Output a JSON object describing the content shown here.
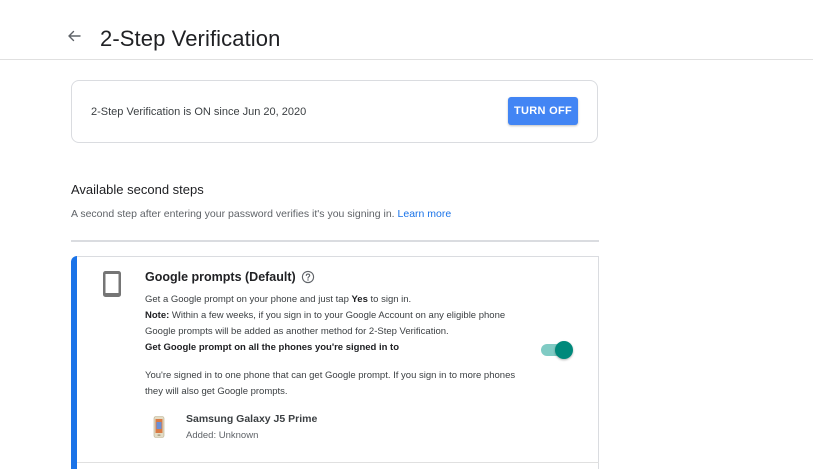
{
  "header": {
    "title": "2-Step Verification",
    "back_icon": "arrow-back-icon"
  },
  "status": {
    "text": "2-Step Verification is ON since Jun 20, 2020",
    "button_label": "TURN OFF",
    "button_color": "#4285f4"
  },
  "section": {
    "title": "Available second steps",
    "description": "A second step after entering your password verifies it's you signing in.",
    "link": "Learn more"
  },
  "prompts": {
    "title": "Google prompts (Default)",
    "accent_color": "#1a73e8",
    "line1_pre": "Get a Google prompt on your phone and just tap ",
    "line1_bold": "Yes",
    "line1_post": " to sign in.",
    "note_label": "Note:",
    "note_line1": " Within a few weeks, if you sign in to your Google Account on any eligible phone",
    "note_line2": "Google prompts will be added as another method for 2-Step Verification.",
    "toggle_label": "Get Google prompt on all the phones you're signed in to",
    "toggle_on": true,
    "toggle_color": "#00897b",
    "info_line1": "You're signed in to one phone that can get Google prompt. If you sign in to more phones",
    "info_line2": "they will also get Google prompts.",
    "device": {
      "name": "Samsung Galaxy J5 Prime",
      "added": "Added: Unknown"
    }
  }
}
